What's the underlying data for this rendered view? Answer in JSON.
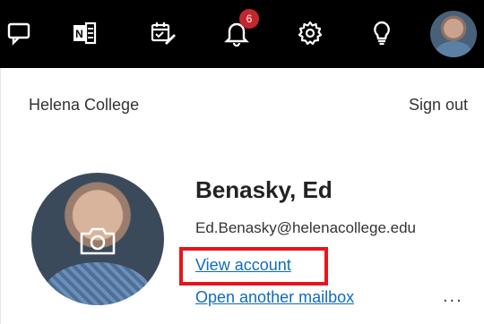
{
  "topbar": {
    "icons": [
      "chat-icon",
      "onenote-icon",
      "calendar-todo-icon",
      "bell-icon",
      "gear-icon",
      "lightbulb-icon",
      "avatar"
    ],
    "notification_count": "6",
    "badge_color": "#c4262e",
    "background": "#000000"
  },
  "panel": {
    "org_name": "Helena College",
    "sign_out_label": "Sign out",
    "user": {
      "name": "Benasky, Ed",
      "email": "Ed.Benasky@helenacollege.edu"
    },
    "links": {
      "view_account": "View account",
      "open_another_mailbox": "Open another mailbox"
    },
    "more_label": "...",
    "highlight_color": "#e8141b",
    "link_color": "#0f6cbd"
  }
}
